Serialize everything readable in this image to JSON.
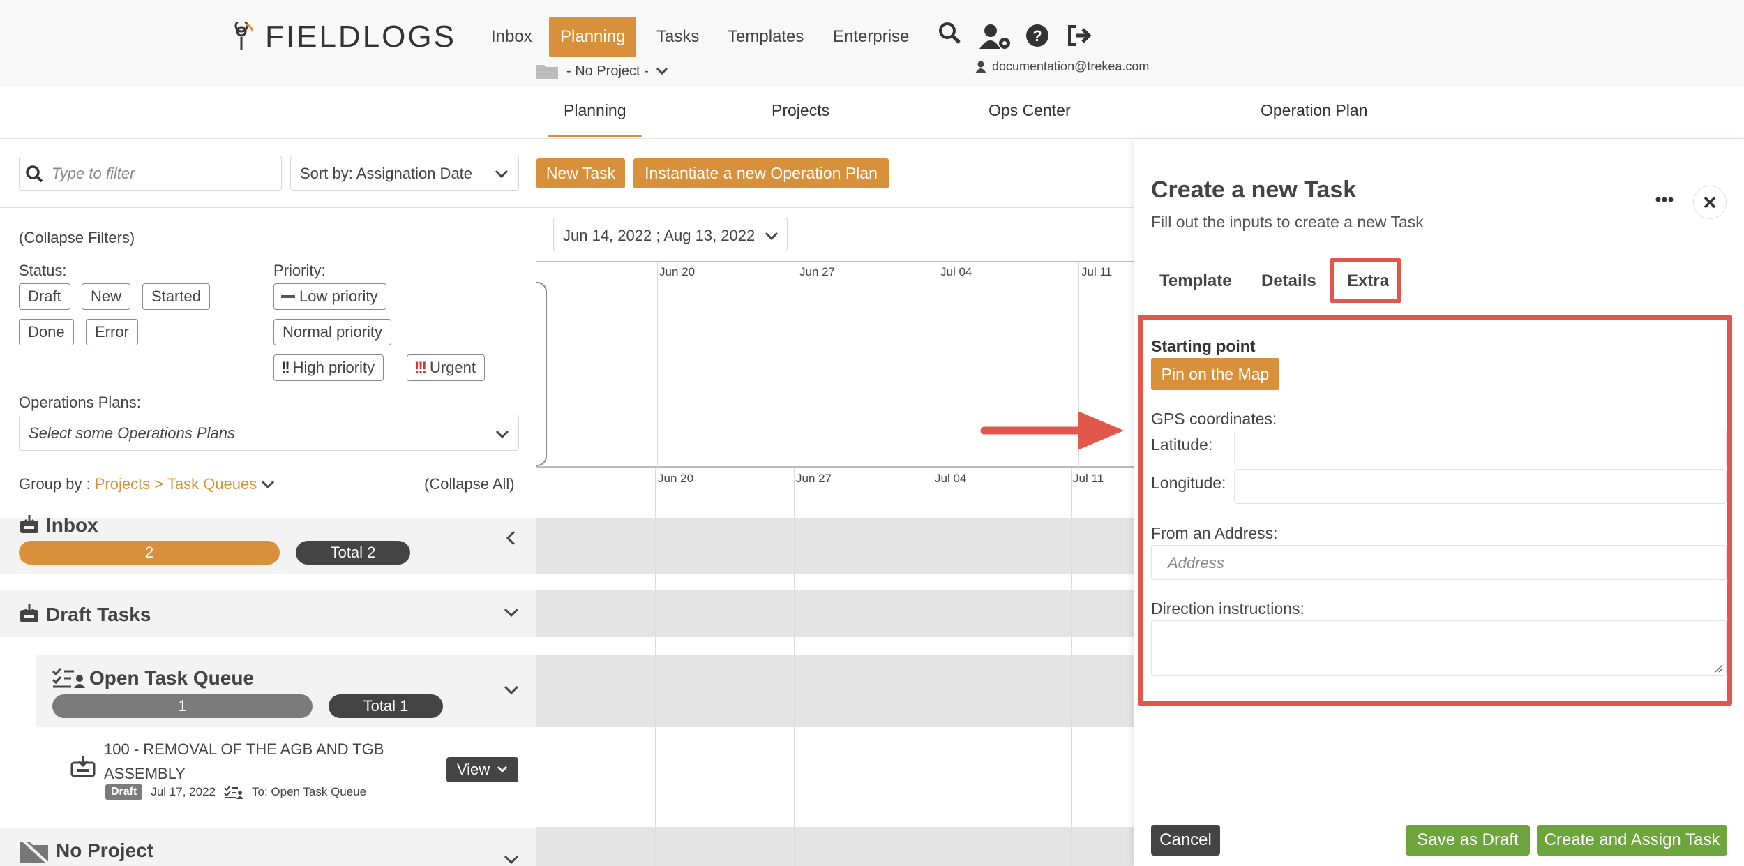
{
  "header": {
    "logo_text": "FIELDLOGS",
    "nav": [
      "Inbox",
      "Planning",
      "Tasks",
      "Templates",
      "Enterprise"
    ],
    "active_nav": "Planning",
    "project_selector": "- No Project -",
    "user_email": "documentation@trekea.com",
    "icons": [
      "search-icon",
      "user-settings-icon",
      "help-icon",
      "logout-icon"
    ]
  },
  "subnav": {
    "tabs": [
      "Planning",
      "Projects",
      "Ops Center",
      "Operation Plan"
    ],
    "active": "Planning"
  },
  "toolbar": {
    "filter_placeholder": "Type to filter",
    "sort_label": "Sort by: Assignation Date",
    "new_task": "New Task",
    "instantiate": "Instantiate a new Operation Plan"
  },
  "filters": {
    "collapse": "(Collapse Filters)",
    "status_label": "Status:",
    "status_tags": [
      "Draft",
      "New",
      "Started",
      "Done",
      "Error"
    ],
    "priority_label": "Priority:",
    "priority_tags": [
      "Low priority",
      "Normal priority",
      "High priority",
      "Urgent"
    ],
    "ops_label": "Operations Plans:",
    "ops_placeholder": "Select some Operations Plans"
  },
  "timeline": {
    "date_range": "Jun 14, 2022 ; Aug 13, 2022",
    "dates": [
      "Jun 20",
      "Jun 27",
      "Jul 04",
      "Jul 11"
    ]
  },
  "grouping": {
    "label": "Group by :",
    "value": "Projects > Task Queues",
    "collapse_all": "(Collapse All)"
  },
  "groups": {
    "inbox": {
      "title": "Inbox",
      "count": "2",
      "total": "Total 2"
    },
    "draft": {
      "title": "Draft Tasks"
    },
    "queue": {
      "title": "Open Task Queue",
      "count": "1",
      "total": "Total 1"
    },
    "task": {
      "title": "100 - REMOVAL OF THE AGB AND TGB ASSEMBLY",
      "status": "Draft",
      "date": "Jul 17, 2022",
      "to": "To: Open Task Queue",
      "view": "View"
    },
    "no_project": {
      "title": "No Project"
    }
  },
  "panel": {
    "title": "Create a new Task",
    "subtitle": "Fill out the inputs to create a new Task",
    "tabs": [
      "Template",
      "Details",
      "Extra"
    ],
    "active_tab": "Extra",
    "starting_point": "Starting point",
    "pin_button": "Pin on the Map",
    "gps_label": "GPS coordinates:",
    "latitude_label": "Latitude:",
    "longitude_label": "Longitude:",
    "latitude_value": "",
    "longitude_value": "",
    "address_label": "From an Address:",
    "address_placeholder": "Address",
    "direction_label": "Direction instructions:",
    "cancel": "Cancel",
    "save_draft": "Save as Draft",
    "create_assign": "Create and Assign Task"
  },
  "colors": {
    "accent": "#d8913a",
    "green": "#6da43c",
    "highlight": "#e2574c",
    "dark_pill": "#444444"
  }
}
